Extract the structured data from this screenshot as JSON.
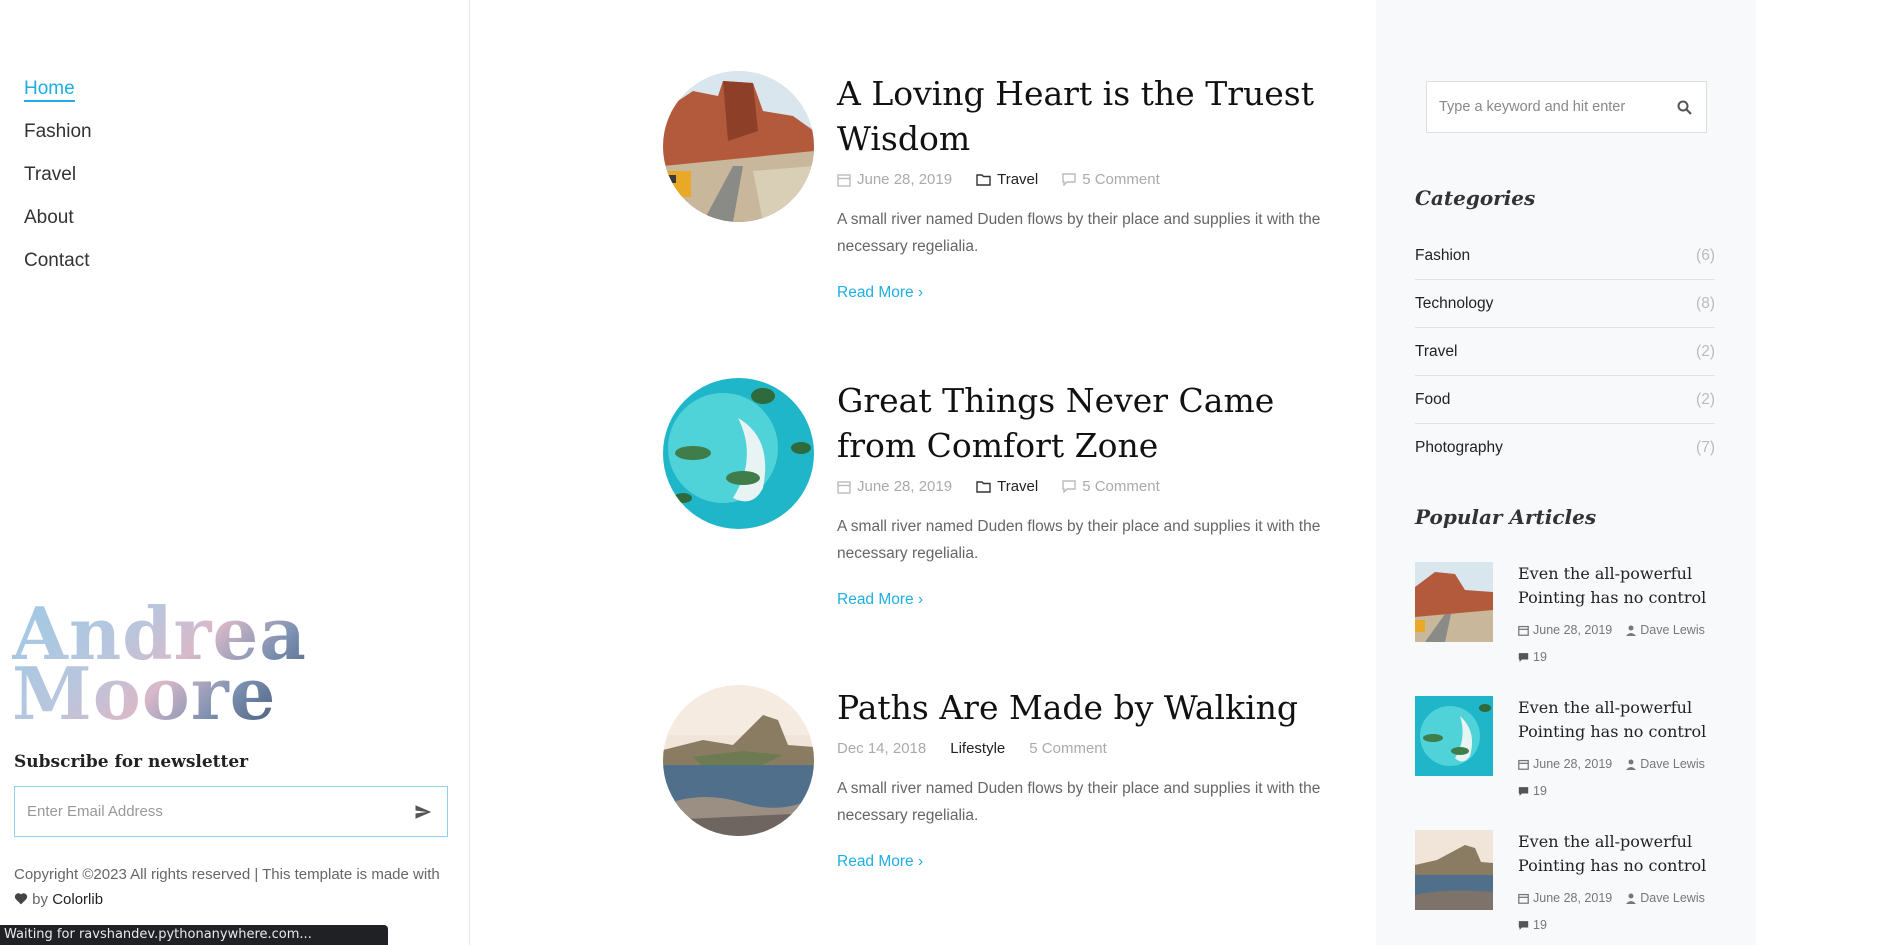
{
  "nav": {
    "items": [
      {
        "label": "Home",
        "active": true
      },
      {
        "label": "Fashion",
        "active": false
      },
      {
        "label": "Travel",
        "active": false
      },
      {
        "label": "About",
        "active": false
      },
      {
        "label": "Contact",
        "active": false
      }
    ]
  },
  "brand": {
    "line1": "Andrea",
    "line2": "Moore"
  },
  "newsletter": {
    "title": "Subscribe for newsletter",
    "placeholder": "Enter Email Address"
  },
  "footer": {
    "copyright_text": "Copyright ©2023 All rights reserved | This template is made with",
    "by": "by",
    "link": "Colorlib"
  },
  "status_bar": "Waiting for ravshandev.pythonanywhere.com...",
  "posts": [
    {
      "title": "A Loving Heart is the Truest Wisdom",
      "date": "June 28, 2019",
      "category": "Travel",
      "comments": "5 Comment",
      "excerpt": "A small river named Duden flows by their place and supplies it with the necessary regelialia.",
      "read_more": "Read More"
    },
    {
      "title": "Great Things Never Came from Comfort Zone",
      "date": "June 28, 2019",
      "category": "Travel",
      "comments": "5 Comment",
      "excerpt": "A small river named Duden flows by their place and supplies it with the necessary regelialia.",
      "read_more": "Read More"
    },
    {
      "title": "Paths Are Made by Walking",
      "date": "Dec 14, 2018",
      "category": "Lifestyle",
      "comments": "5 Comment",
      "excerpt": "A small river named Duden flows by their place and supplies it with the necessary regelialia.",
      "read_more": "Read More"
    }
  ],
  "sidebar": {
    "search_placeholder": "Type a keyword and hit enter",
    "categories_title": "Categories",
    "categories": [
      {
        "name": "Fashion",
        "count": "(6)"
      },
      {
        "name": "Technology",
        "count": "(8)"
      },
      {
        "name": "Travel",
        "count": "(2)"
      },
      {
        "name": "Food",
        "count": "(2)"
      },
      {
        "name": "Photography",
        "count": "(7)"
      }
    ],
    "popular_title": "Popular Articles",
    "popular": [
      {
        "title": "Even the all-powerful Pointing has no control",
        "date": "June 28, 2019",
        "author": "Dave Lewis",
        "comments": "19"
      },
      {
        "title": "Even the all-powerful Pointing has no control",
        "date": "June 28, 2019",
        "author": "Dave Lewis",
        "comments": "19"
      },
      {
        "title": "Even the all-powerful Pointing has no control",
        "date": "June 28, 2019",
        "author": "Dave Lewis",
        "comments": "19"
      }
    ]
  },
  "colors": {
    "accent": "#1eaee4",
    "sidebar_bg": "#f8f9fb"
  },
  "icons": [
    "calendar-icon",
    "folder-icon",
    "comment-icon",
    "chevron-right-icon",
    "search-icon",
    "paper-plane-icon",
    "heart-icon",
    "person-icon"
  ]
}
